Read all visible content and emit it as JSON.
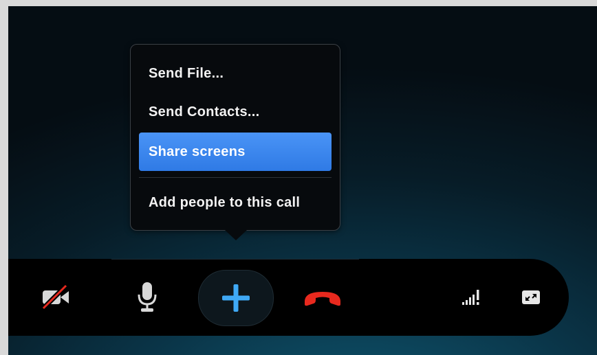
{
  "menu": {
    "items": [
      {
        "label": "Send File..."
      },
      {
        "label": "Send Contacts..."
      },
      {
        "label": "Share screens"
      },
      {
        "label": "Add people to this call"
      }
    ]
  },
  "toolbar": {
    "buttons": [
      {
        "name": "video-off",
        "icon": "video-camera-off-icon"
      },
      {
        "name": "microphone",
        "icon": "microphone-icon"
      },
      {
        "name": "add",
        "icon": "plus-icon"
      },
      {
        "name": "hang-up",
        "icon": "phone-hangup-icon"
      },
      {
        "name": "call-quality",
        "icon": "signal-strength-icon"
      },
      {
        "name": "fullscreen",
        "icon": "fullscreen-icon"
      }
    ]
  },
  "colors": {
    "highlight": "#3b86ee",
    "plus": "#3fa9f5",
    "hangup": "#e8291e"
  }
}
